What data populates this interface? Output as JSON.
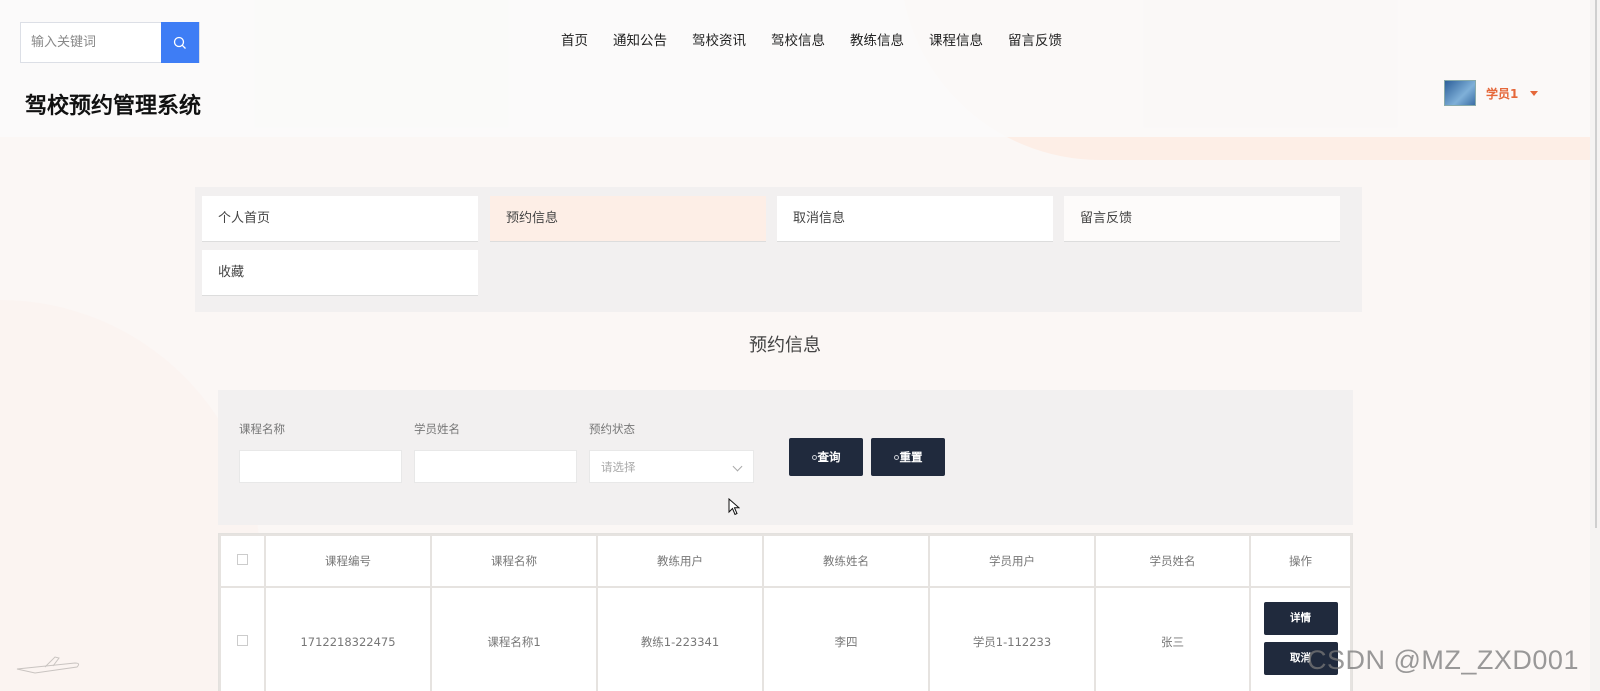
{
  "header": {
    "search_placeholder": "输入关键词",
    "nav": [
      "首页",
      "通知公告",
      "驾校资讯",
      "驾校信息",
      "教练信息",
      "课程信息",
      "留言反馈"
    ],
    "site_title": "驾校预约管理系统",
    "user_name": "学员1"
  },
  "menu": {
    "items": [
      "个人首页",
      "预约信息",
      "取消信息",
      "留言反馈",
      "收藏"
    ],
    "active_index": 1
  },
  "section_title": "预约信息",
  "filters": {
    "course_name_label": "课程名称",
    "course_name_value": "",
    "student_name_label": "学员姓名",
    "student_name_value": "",
    "status_label": "预约状态",
    "status_placeholder": "请选择",
    "query_button": "查询",
    "reset_button": "重置"
  },
  "table": {
    "columns": [
      "课程编号",
      "课程名称",
      "教练用户",
      "教练姓名",
      "学员用户",
      "学员姓名",
      "操作"
    ],
    "rows": [
      {
        "course_no": "1712218322475",
        "course_name": "课程名称1",
        "coach_user": "教练1-223341",
        "coach_name": "李四",
        "student_user": "学员1-112233",
        "student_name": "张三",
        "actions": [
          "详情",
          "取消"
        ]
      }
    ]
  },
  "watermark": "CSDN @MZ_ZXD001",
  "colors": {
    "accent": "#3e7df5",
    "dark_button": "#202a3d",
    "user_orange": "#e5683a",
    "active_menu": "#fdeee6"
  }
}
